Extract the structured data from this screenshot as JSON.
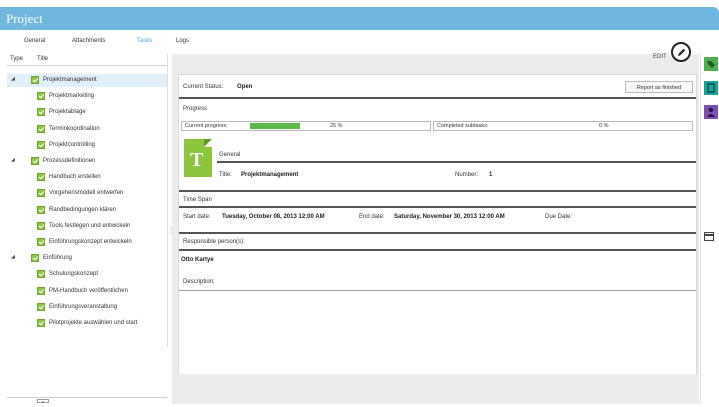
{
  "window": {
    "title": "Project"
  },
  "tabs": [
    {
      "label": "General",
      "active": false
    },
    {
      "label": "Attachments",
      "active": false
    },
    {
      "label": "Tasks",
      "active": true
    },
    {
      "label": "Logs",
      "active": false
    }
  ],
  "tree": {
    "columns": [
      "Type",
      "Title"
    ],
    "items": [
      {
        "label": "Projektmanagement",
        "level": 0,
        "expanded": true,
        "selected": true
      },
      {
        "label": "Projektmarketing",
        "level": 1
      },
      {
        "label": "Projektablage",
        "level": 1
      },
      {
        "label": "Terminkoordination",
        "level": 1
      },
      {
        "label": "Projektcontrolling",
        "level": 1
      },
      {
        "label": "Prozessdefinitionen",
        "level": 0,
        "expanded": true
      },
      {
        "label": "Handbuch erstellen",
        "level": 1
      },
      {
        "label": "Vorgehensmodell entwerfen",
        "level": 1
      },
      {
        "label": "Randbedingungen klären",
        "level": 1
      },
      {
        "label": "Tools festlegen und entwickeln",
        "level": 1
      },
      {
        "label": "Einführungskonzept entwickeln",
        "level": 1
      },
      {
        "label": "Einführung",
        "level": 0,
        "expanded": true
      },
      {
        "label": "Schulungskonzept",
        "level": 1
      },
      {
        "label": "PM-Handbuch veröffentlichen",
        "level": 1
      },
      {
        "label": "Einführungsveranstaltung",
        "level": 1
      },
      {
        "label": "Pilotprojekte auswählen und start",
        "level": 1
      }
    ]
  },
  "toolbar": {
    "edit_label": "EDIT"
  },
  "detail": {
    "status_label": "Current Status:",
    "status_value": "Open",
    "report_button": "Report as finished",
    "progress_section": "Progress",
    "current_progress_label": "Current progress:",
    "current_progress_value": "25 %",
    "current_progress_fraction": 0.25,
    "completed_subtasks_label": "Completed subtasks:",
    "completed_subtasks_value": "0 %",
    "general_section": "General",
    "title_label": "Title:",
    "title_value": "Projektmanagement",
    "number_label": "Number:",
    "number_value": "1",
    "timespan_section": "Time Span",
    "start_label": "Start date:",
    "start_value": "Tuesday, October 08, 2013 12:00 AM",
    "end_label": "End date:",
    "end_value": "Saturday, November 30, 2013 12:00 AM",
    "due_label": "Due Date:",
    "responsible_section": "Responsible person(s):",
    "responsible_value": "Otto Kartye",
    "description_section": "Description:"
  },
  "colors": {
    "titlebar": "#6fb7df",
    "accent_green": "#8cc63f",
    "progress_green": "#5db84a",
    "side_green": "#4caf50",
    "side_teal": "#1aa39a",
    "side_purple": "#7b4fb3"
  },
  "side_icons": [
    "tag-icon",
    "copy-icon",
    "users-icon",
    "calendar-icon"
  ]
}
